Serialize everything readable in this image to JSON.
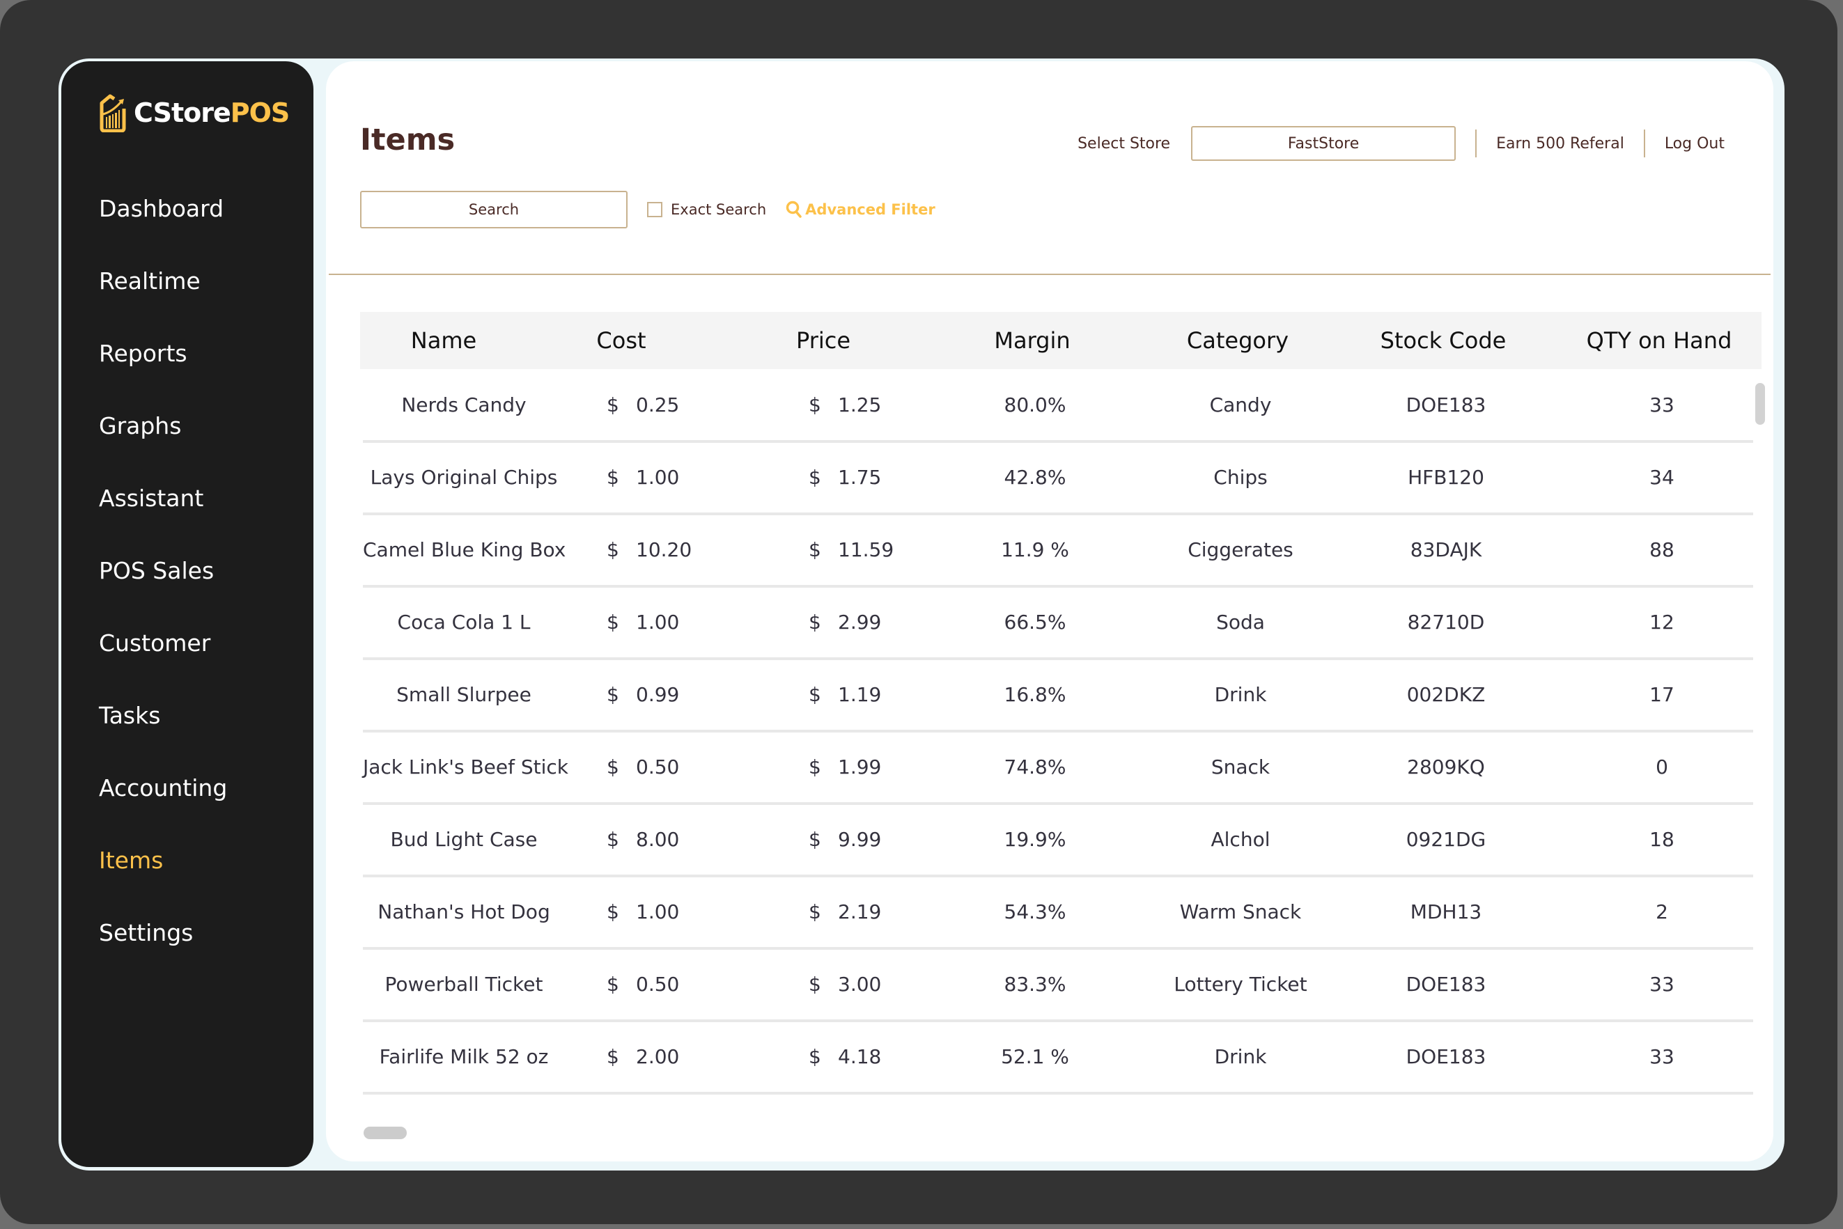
{
  "app": {
    "brand_part1": "CStore",
    "brand_part2": "POS"
  },
  "sidebar": {
    "items": [
      {
        "label": "Dashboard",
        "active": false
      },
      {
        "label": "Realtime",
        "active": false
      },
      {
        "label": "Reports",
        "active": false
      },
      {
        "label": "Graphs",
        "active": false
      },
      {
        "label": "Assistant",
        "active": false
      },
      {
        "label": "POS Sales",
        "active": false
      },
      {
        "label": "Customer",
        "active": false
      },
      {
        "label": "Tasks",
        "active": false
      },
      {
        "label": "Accounting",
        "active": false
      },
      {
        "label": "Items",
        "active": true
      },
      {
        "label": "Settings",
        "active": false
      }
    ]
  },
  "header": {
    "title": "Items",
    "select_store_label": "Select Store",
    "store_value": "FastStore",
    "referral_link": "Earn 500 Referal",
    "logout_link": "Log Out"
  },
  "search": {
    "placeholder": "Search",
    "exact_search_label": "Exact Search",
    "exact_search_checked": false,
    "advanced_filter_label": "Advanced Filter"
  },
  "colors": {
    "accent": "#fcc14a",
    "text_brown": "#4a2a26",
    "border_tan": "#c8b28f",
    "sidebar_bg": "#1c1c1c"
  },
  "table": {
    "columns": [
      "Name",
      "Cost",
      "Price",
      "Margin",
      "Category",
      "Stock Code",
      "QTY on Hand"
    ],
    "currency_symbol": "$",
    "rows": [
      {
        "name": "Nerds Candy",
        "cost": "0.25",
        "price": "1.25",
        "margin": "80.0%",
        "category": "Candy",
        "stock_code": "DOE183",
        "qty": "33"
      },
      {
        "name": "Lays Original Chips",
        "cost": "1.00",
        "price": "1.75",
        "margin": "42.8%",
        "category": "Chips",
        "stock_code": "HFB120",
        "qty": "34"
      },
      {
        "name": "Camel Blue King Box",
        "cost": "10.20",
        "price": "11.59",
        "margin": "11.9 %",
        "category": "Ciggerates",
        "stock_code": "83DAJK",
        "qty": "88"
      },
      {
        "name": "Coca Cola 1 L",
        "cost": "1.00",
        "price": "2.99",
        "margin": "66.5%",
        "category": "Soda",
        "stock_code": "82710D",
        "qty": "12"
      },
      {
        "name": "Small Slurpee",
        "cost": "0.99",
        "price": "1.19",
        "margin": "16.8%",
        "category": "Drink",
        "stock_code": "002DKZ",
        "qty": "17"
      },
      {
        "name": "Jack Link's Beef Stick",
        "cost": "0.50",
        "price": "1.99",
        "margin": "74.8%",
        "category": "Snack",
        "stock_code": "2809KQ",
        "qty": "0"
      },
      {
        "name": "Bud Light Case",
        "cost": "8.00",
        "price": "9.99",
        "margin": "19.9%",
        "category": "Alchol",
        "stock_code": "0921DG",
        "qty": "18"
      },
      {
        "name": "Nathan's Hot Dog",
        "cost": "1.00",
        "price": "2.19",
        "margin": "54.3%",
        "category": "Warm Snack",
        "stock_code": "MDH13",
        "qty": "2"
      },
      {
        "name": "Powerball Ticket",
        "cost": "0.50",
        "price": "3.00",
        "margin": "83.3%",
        "category": "Lottery Ticket",
        "stock_code": "DOE183",
        "qty": "33"
      },
      {
        "name": "Fairlife Milk 52 oz",
        "cost": "2.00",
        "price": "4.18",
        "margin": "52.1 %",
        "category": "Drink",
        "stock_code": "DOE183",
        "qty": "33"
      }
    ]
  }
}
